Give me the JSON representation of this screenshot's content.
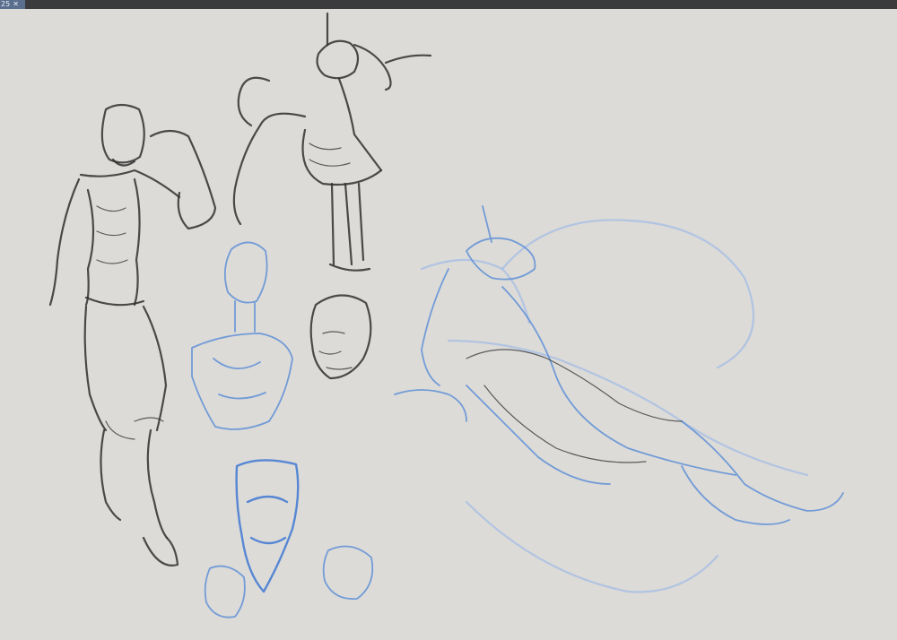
{
  "tab": {
    "label": "25",
    "close_glyph": "✕"
  },
  "colors": {
    "toolbar": "#3b3b3e",
    "tab": "#5a6f8d",
    "paper": "#dcdbd8",
    "pencil": "#2f2f2f",
    "blue_sketch": "#5f8fd6"
  }
}
